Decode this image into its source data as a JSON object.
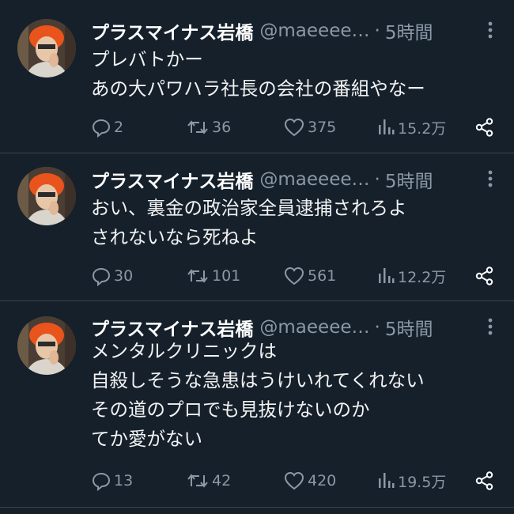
{
  "tweets": [
    {
      "display_name": "プラスマイナス岩橋",
      "handle": "@maeeee…",
      "separator": "·",
      "time": "5時間",
      "lines": [
        "プレバトかー",
        "あの大パワハラ社長の会社の番組やなー"
      ],
      "replies": "2",
      "retweets": "36",
      "likes": "375",
      "views": "15.2万"
    },
    {
      "display_name": "プラスマイナス岩橋",
      "handle": "@maeeee…",
      "separator": "·",
      "time": "5時間",
      "lines": [
        "おい、裏金の政治家全員逮捕されろよ",
        "されないなら死ねよ"
      ],
      "replies": "30",
      "retweets": "101",
      "likes": "561",
      "views": "12.2万"
    },
    {
      "display_name": "プラスマイナス岩橋",
      "handle": "@maeeee…",
      "separator": "·",
      "time": "5時間",
      "lines": [
        "メンタルクリニックは",
        "自殺しそうな急患はうけいれてくれない",
        "その道のプロでも見抜けないのか",
        "てか愛がない"
      ],
      "replies": "13",
      "retweets": "42",
      "likes": "420",
      "views": "19.5万"
    }
  ],
  "icons": {
    "more": "more-icon",
    "reply": "reply-icon",
    "retweet": "retweet-icon",
    "like": "heart-icon",
    "views": "views-icon",
    "share": "share-icon"
  },
  "colors": {
    "background": "#15202b",
    "secondary_text": "#8b98a5",
    "divider": "#38444d",
    "avatar_hair": "#e8541c"
  }
}
